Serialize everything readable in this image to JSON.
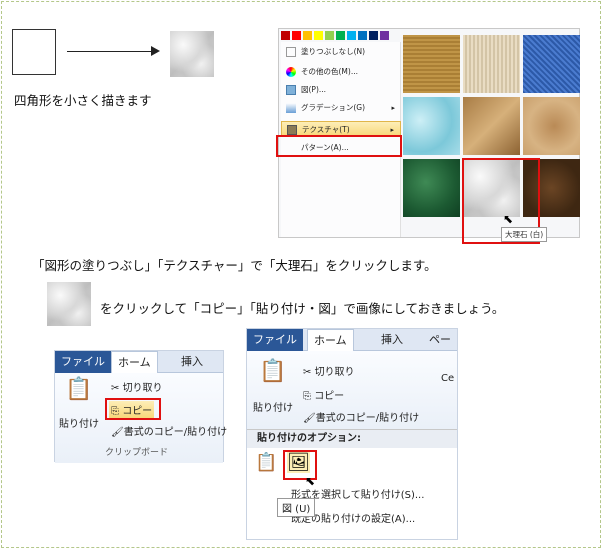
{
  "step1": {
    "caption": "四角形を小さく描きます"
  },
  "gallery": {
    "menu": {
      "no_fill": "塗りつぶしなし(N)",
      "more_colors": "その他の色(M)...",
      "picture": "図(P)...",
      "gradient": "グラデーション(G)",
      "texture": "テクスチャ(T)",
      "pattern": "パターン(A)..."
    },
    "tooltip": "大理石 (白)",
    "palette_colors": [
      "#c00000",
      "#ff0000",
      "#ffc000",
      "#ffff00",
      "#92d050",
      "#00b050",
      "#00b0f0",
      "#0070c0",
      "#002060",
      "#7030a0"
    ]
  },
  "instruction1": "「図形の塗りつぶし」「テクスチャー」で「大理石」をクリックします。",
  "instruction2": "をクリックして「コピー」「貼り付け・図」で画像にしておきましょう。",
  "ribbon_small": {
    "tab_file": "ファイル",
    "tab_home": "ホーム",
    "tab_insert": "挿入",
    "paste": "貼り付け",
    "cut": "切り取り",
    "copy": "コピー",
    "format_painter": "書式のコピー/貼り付け",
    "group_label": "クリップボード"
  },
  "ribbon_large": {
    "tab_file": "ファイル",
    "tab_home": "ホーム",
    "tab_insert": "挿入",
    "tab_page": "ページ",
    "paste": "貼り付け",
    "cut": "切り取り",
    "copy": "コピー",
    "format_painter": "書式のコピー/貼り付け",
    "font_cut": "Ce",
    "paste_options_header": "貼り付けのオプション:",
    "paste_special": "形式を選択して貼り付け(S)...",
    "set_default": "既定の貼り付けの設定(A)...",
    "tooltip": "図 (U)"
  }
}
